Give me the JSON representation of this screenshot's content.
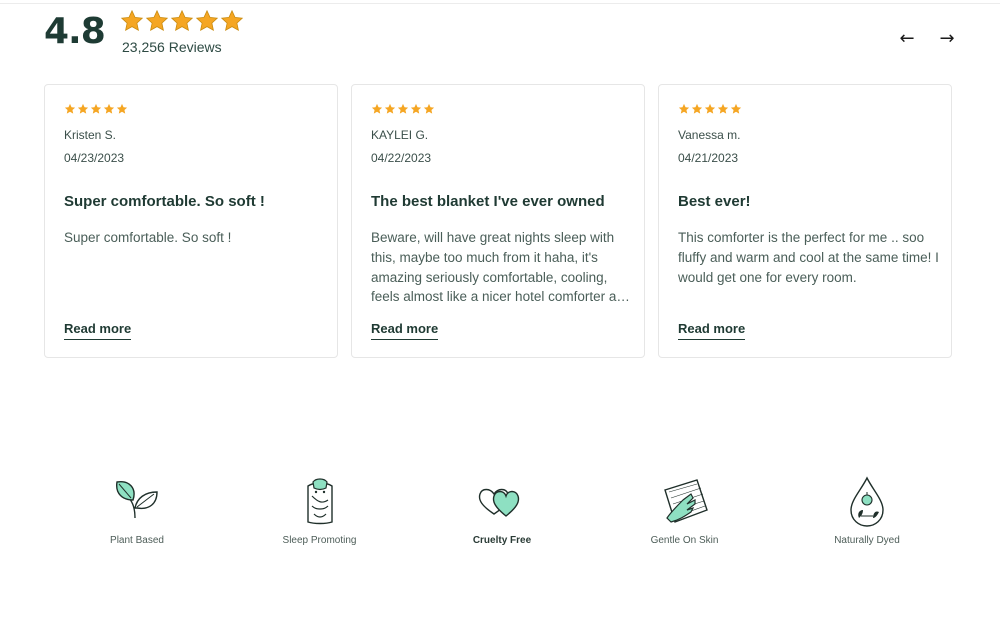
{
  "summary": {
    "rating": "4.8",
    "stars": 5,
    "star_color": "#f5a623",
    "reviews_count": "23,256 Reviews"
  },
  "nav": {
    "prev_icon": "←",
    "next_icon": "→"
  },
  "reviews": [
    {
      "stars": 5,
      "author": "Kristen S.",
      "date": "04/23/2023",
      "title": "Super comfortable. So soft !",
      "body": "Super comfortable. So soft !",
      "read_more": "Read more"
    },
    {
      "stars": 5,
      "author": "KAYLEI G.",
      "date": "04/22/2023",
      "title": "The best blanket I've ever owned",
      "body": "Beware, will have great nights sleep with this, maybe too much from it haha, it's amazing seriously comfortable, cooling, feels almost like a nicer hotel comforter and so soft.",
      "read_more": "Read more"
    },
    {
      "stars": 5,
      "author": "Vanessa m.",
      "date": "04/21/2023",
      "title": "Best ever!",
      "body": "This comforter is the perfect for me .. soo fluffy and warm and cool at the same time! I would get one for every room.",
      "read_more": "Read more"
    }
  ],
  "features": [
    {
      "icon": "leaf-icon",
      "label": "Plant Based"
    },
    {
      "icon": "sleeping-pillow-icon",
      "label": "Sleep Promoting"
    },
    {
      "icon": "hearts-icon",
      "label": "Cruelty Free"
    },
    {
      "icon": "hand-on-fabric-icon",
      "label": "Gentle On Skin"
    },
    {
      "icon": "dye-drop-icon",
      "label": "Naturally Dyed"
    }
  ],
  "colors": {
    "accent_mint": "#8ee0c2",
    "text_dark": "#1f3a33",
    "star": "#f5a623"
  }
}
